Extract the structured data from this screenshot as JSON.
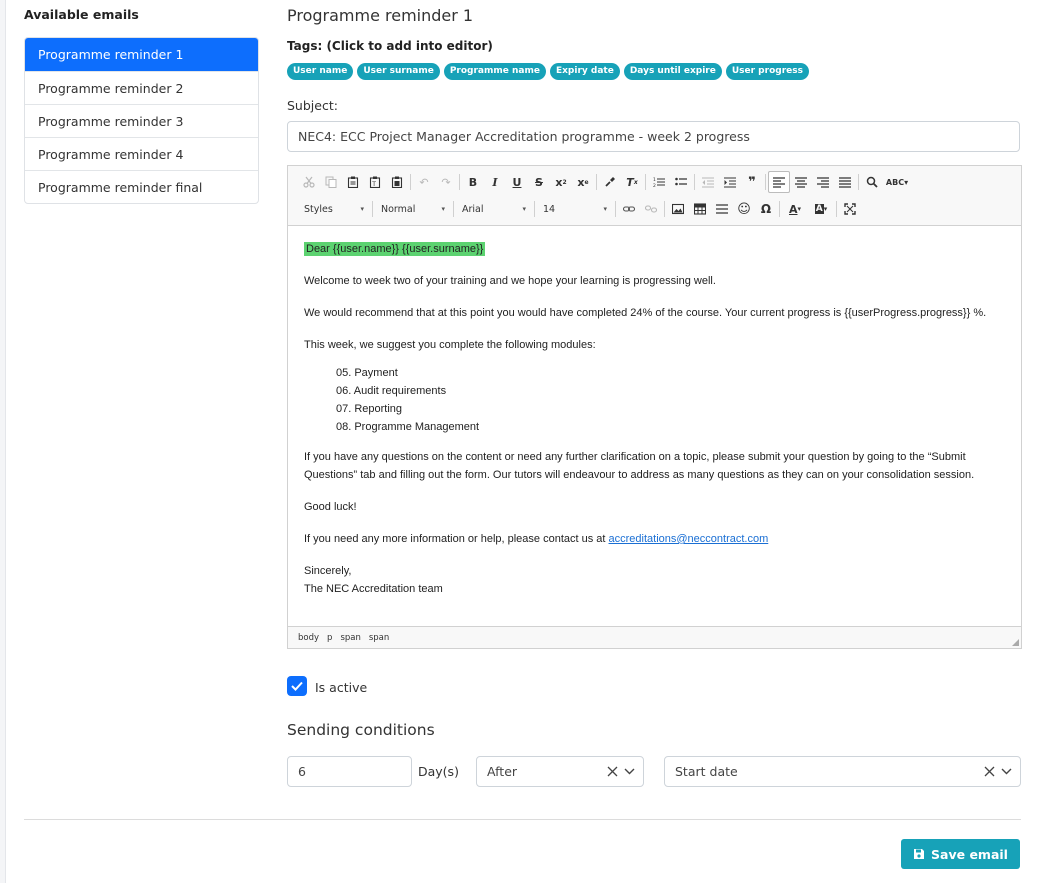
{
  "sidebar": {
    "title": "Available emails",
    "items": [
      {
        "label": "Programme reminder 1",
        "active": true
      },
      {
        "label": "Programme reminder 2"
      },
      {
        "label": "Programme reminder 3"
      },
      {
        "label": "Programme reminder 4"
      },
      {
        "label": "Programme reminder final"
      }
    ]
  },
  "main": {
    "title": "Programme reminder 1",
    "tags_label": "Tags: (Click to add into editor)",
    "tags": [
      "User name",
      "User surname",
      "Programme name",
      "Expiry date",
      "Days until expire",
      "User progress"
    ],
    "subject_label": "Subject:",
    "subject_value": "NEC4: ECC Project Manager Accreditation programme - week 2 progress"
  },
  "editor": {
    "toolbar": {
      "styles": "Styles",
      "format": "Normal",
      "font": "Arial",
      "size": "14"
    },
    "body": {
      "greeting": "Dear {{user.name}} {{user.surname}}",
      "p1": "Welcome to week two of your training and we hope your learning is progressing well.",
      "p2": "We would recommend that at this point you would have completed 24% of the course. Your current progress is {{userProgress.progress}} %.",
      "p3": "This week, we suggest you complete the following modules:",
      "modules": [
        "05. Payment",
        "06. Audit requirements",
        "07. Reporting",
        "08. Programme Management"
      ],
      "p4": "If you have any questions on the content or need any further clarification on a topic, please submit your question by going to the “Submit Questions” tab and filling out the form. Our tutors will endeavour to address as many questions as they can on your consolidation session.",
      "p5": "Good luck!",
      "p6_prefix": "If you need any more information or help, please contact us at ",
      "p6_email": "accreditations@neccontract.com",
      "sign1": "Sincerely,",
      "sign2": "The NEC Accreditation team"
    },
    "path": [
      "body",
      "p",
      "span",
      "span"
    ]
  },
  "is_active": {
    "label": "Is active",
    "checked": true
  },
  "sending": {
    "title": "Sending conditions",
    "days_value": "6",
    "days_label": "Day(s)",
    "relation": "After",
    "event": "Start date"
  },
  "actions": {
    "save_label": "Save email"
  },
  "colors": {
    "primary": "#0d6efd",
    "info": "#17a2b8",
    "highlight": "#5cd270"
  }
}
